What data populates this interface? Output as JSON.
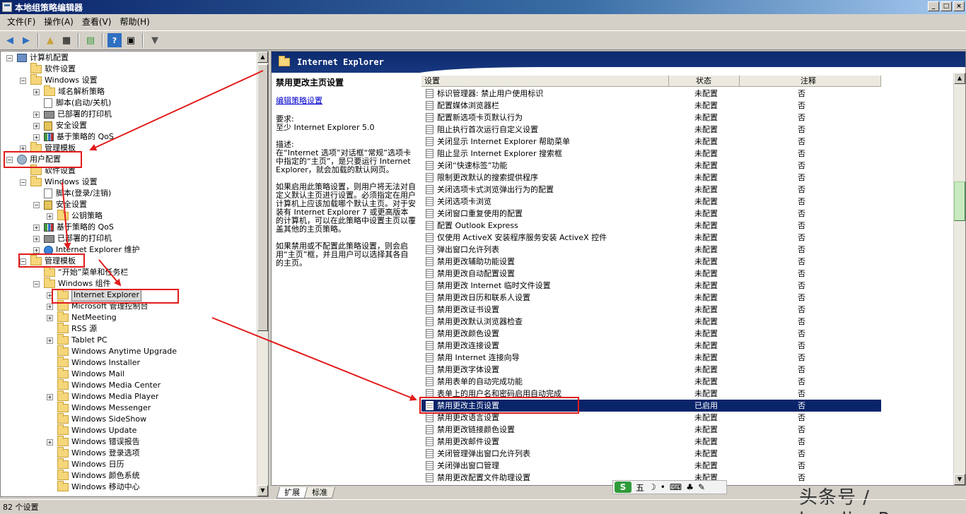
{
  "window": {
    "title": "本地组策略编辑器",
    "min": "_",
    "max": "□",
    "close": "×"
  },
  "menu": [
    "文件(F)",
    "操作(A)",
    "查看(V)",
    "帮助(H)"
  ],
  "tree": [
    {
      "label": "计算机配置",
      "exp": "−",
      "icon": "pc",
      "level": 0
    },
    {
      "label": "软件设置",
      "exp": "",
      "icon": "folder",
      "level": 1
    },
    {
      "label": "Windows 设置",
      "exp": "−",
      "icon": "folder",
      "level": 1
    },
    {
      "label": "域名解析策略",
      "exp": "+",
      "icon": "folder",
      "level": 2
    },
    {
      "label": "脚本(启动/关机)",
      "exp": "",
      "icon": "doc",
      "level": 2
    },
    {
      "label": "已部署的打印机",
      "exp": "+",
      "icon": "printer",
      "level": 2
    },
    {
      "label": "安全设置",
      "exp": "+",
      "icon": "lock",
      "level": 2
    },
    {
      "label": "基于策略的 QoS",
      "exp": "+",
      "icon": "chart",
      "level": 2
    },
    {
      "label": "管理模板",
      "exp": "+",
      "icon": "folder",
      "level": 1
    },
    {
      "label": "用户配置",
      "exp": "−",
      "icon": "user",
      "level": 0
    },
    {
      "label": "软件设置",
      "exp": "",
      "icon": "folder",
      "level": 1
    },
    {
      "label": "Windows 设置",
      "exp": "−",
      "icon": "folder",
      "level": 1
    },
    {
      "label": "脚本(登录/注销)",
      "exp": "",
      "icon": "doc",
      "level": 2
    },
    {
      "label": "安全设置",
      "exp": "−",
      "icon": "lock",
      "level": 2
    },
    {
      "label": "公钥策略",
      "exp": "+",
      "icon": "folder",
      "level": 3
    },
    {
      "label": "基于策略的 QoS",
      "exp": "+",
      "icon": "chart",
      "level": 2
    },
    {
      "label": "已部署的打印机",
      "exp": "+",
      "icon": "printer",
      "level": 2
    },
    {
      "label": "Internet Explorer 维护",
      "exp": "+",
      "icon": "ie",
      "level": 2
    },
    {
      "label": "管理模板",
      "exp": "−",
      "icon": "folder",
      "level": 1
    },
    {
      "label": "“开始”菜单和任务栏",
      "exp": "",
      "icon": "folder",
      "level": 2
    },
    {
      "label": "Windows 组件",
      "exp": "−",
      "icon": "folder",
      "level": 2
    },
    {
      "label": "Internet Explorer",
      "exp": "+",
      "icon": "folder",
      "level": 3,
      "selected": true
    },
    {
      "label": "Microsoft 管理控制台",
      "exp": "+",
      "icon": "folder",
      "level": 3
    },
    {
      "label": "NetMeeting",
      "exp": "+",
      "icon": "folder",
      "level": 3
    },
    {
      "label": "RSS 源",
      "exp": "",
      "icon": "folder",
      "level": 3
    },
    {
      "label": "Tablet PC",
      "exp": "+",
      "icon": "folder",
      "level": 3
    },
    {
      "label": "Windows Anytime Upgrade",
      "exp": "",
      "icon": "folder",
      "level": 3
    },
    {
      "label": "Windows Installer",
      "exp": "",
      "icon": "folder",
      "level": 3
    },
    {
      "label": "Windows Mail",
      "exp": "",
      "icon": "folder",
      "level": 3
    },
    {
      "label": "Windows Media Center",
      "exp": "",
      "icon": "folder",
      "level": 3
    },
    {
      "label": "Windows Media Player",
      "exp": "+",
      "icon": "folder",
      "level": 3
    },
    {
      "label": "Windows Messenger",
      "exp": "",
      "icon": "folder",
      "level": 3
    },
    {
      "label": "Windows SideShow",
      "exp": "",
      "icon": "folder",
      "level": 3
    },
    {
      "label": "Windows Update",
      "exp": "",
      "icon": "folder",
      "level": 3
    },
    {
      "label": "Windows 错误报告",
      "exp": "+",
      "icon": "folder",
      "level": 3
    },
    {
      "label": "Windows 登录选项",
      "exp": "",
      "icon": "folder",
      "level": 3
    },
    {
      "label": "Windows 日历",
      "exp": "",
      "icon": "folder",
      "level": 3
    },
    {
      "label": "Windows 颜色系统",
      "exp": "",
      "icon": "folder",
      "level": 3
    },
    {
      "label": "Windows 移动中心",
      "exp": "",
      "icon": "folder",
      "level": 3
    }
  ],
  "right": {
    "banner": "Internet Explorer",
    "desc_title": "禁用更改主页设置",
    "edit_link": "编辑策略设置",
    "requirements": "要求:\n至少 Internet Explorer 5.0",
    "description": "描述:\n在“Internet 选项”对话框“常规”选项卡中指定的“主页”，是只要运行 Internet Explorer，就会加载的默认网页。",
    "para2": "如果启用此策略设置，则用户将无法对自定义默认主页进行设置。必须指定在用户计算机上应该加载哪个默认主页。对于安装有 Internet Explorer 7 或更高版本的计算机，可以在此策略中设置主页以覆盖其他的主页策略。",
    "para3": "如果禁用或不配置此策略设置，则会启用“主页”框，并且用户可以选择其各自的主页。",
    "columns": [
      "设置",
      "状态",
      "注释"
    ],
    "rows": [
      {
        "name": "标识管理器: 禁止用户使用标识",
        "state": "未配置",
        "note": "否"
      },
      {
        "name": "配置媒体浏览器栏",
        "state": "未配置",
        "note": "否"
      },
      {
        "name": "配置新选项卡页默认行为",
        "state": "未配置",
        "note": "否"
      },
      {
        "name": "阻止执行首次运行自定义设置",
        "state": "未配置",
        "note": "否"
      },
      {
        "name": "关闭显示 Internet Explorer 帮助菜单",
        "state": "未配置",
        "note": "否"
      },
      {
        "name": "阻止显示 Internet Explorer 搜索框",
        "state": "未配置",
        "note": "否"
      },
      {
        "name": "关闭“快速标签”功能",
        "state": "未配置",
        "note": "否"
      },
      {
        "name": "限制更改默认的搜索提供程序",
        "state": "未配置",
        "note": "否"
      },
      {
        "name": "关闭选项卡式浏览弹出行为的配置",
        "state": "未配置",
        "note": "否"
      },
      {
        "name": "关闭选项卡浏览",
        "state": "未配置",
        "note": "否"
      },
      {
        "name": "关闭窗口重复使用的配置",
        "state": "未配置",
        "note": "否"
      },
      {
        "name": "配置 Outlook Express",
        "state": "未配置",
        "note": "否"
      },
      {
        "name": "仅使用 ActiveX 安装程序服务安装 ActiveX 控件",
        "state": "未配置",
        "note": "否"
      },
      {
        "name": "弹出窗口允许列表",
        "state": "未配置",
        "note": "否"
      },
      {
        "name": "禁用更改辅助功能设置",
        "state": "未配置",
        "note": "否"
      },
      {
        "name": "禁用更改自动配置设置",
        "state": "未配置",
        "note": "否"
      },
      {
        "name": "禁用更改 Internet 临时文件设置",
        "state": "未配置",
        "note": "否"
      },
      {
        "name": "禁用更改日历和联系人设置",
        "state": "未配置",
        "note": "否"
      },
      {
        "name": "禁用更改证书设置",
        "state": "未配置",
        "note": "否"
      },
      {
        "name": "禁用更改默认浏览器检查",
        "state": "未配置",
        "note": "否"
      },
      {
        "name": "禁用更改颜色设置",
        "state": "未配置",
        "note": "否"
      },
      {
        "name": "禁用更改连接设置",
        "state": "未配置",
        "note": "否"
      },
      {
        "name": "禁用 Internet 连接向导",
        "state": "未配置",
        "note": "否"
      },
      {
        "name": "禁用更改字体设置",
        "state": "未配置",
        "note": "否"
      },
      {
        "name": "禁用表单的自动完成功能",
        "state": "未配置",
        "note": "否"
      },
      {
        "name": "表单上的用户名和密码启用自动完成",
        "state": "未配置",
        "note": "否"
      },
      {
        "name": "禁用更改主页设置",
        "state": "已启用",
        "note": "否",
        "selected": true
      },
      {
        "name": "禁用更改语言设置",
        "state": "未配置",
        "note": "否"
      },
      {
        "name": "禁用更改链接颜色设置",
        "state": "未配置",
        "note": "否"
      },
      {
        "name": "禁用更改邮件设置",
        "state": "未配置",
        "note": "否"
      },
      {
        "name": "关闭管理弹出窗口允许列表",
        "state": "未配置",
        "note": "否"
      },
      {
        "name": "关闭弹出窗口管理",
        "state": "未配置",
        "note": "否"
      },
      {
        "name": "禁用更改配置文件助理设置",
        "state": "未配置",
        "note": "否"
      }
    ]
  },
  "tabs": [
    "扩展",
    "标准"
  ],
  "status": "82 个设置",
  "ime": {
    "logo": "S",
    "mode": "五"
  },
  "watermark": "头条号 / longlingPc",
  "colors": {
    "annotation": "#e21b1b",
    "selection": "#0a246a",
    "banner": "#0c2a6e"
  }
}
